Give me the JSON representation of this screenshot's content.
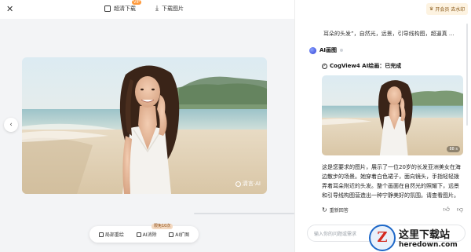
{
  "topbar": {
    "hd_download_label": "超清下载",
    "vip_badge": "VIP",
    "download_label": "下载图片"
  },
  "image": {
    "watermark": "清言·AI"
  },
  "actions": {
    "free_badge": "限免10次",
    "items": [
      {
        "label": "局部重绘"
      },
      {
        "label": "AI消除"
      },
      {
        "label": "AI扩图"
      }
    ]
  },
  "chat": {
    "upgrade_label": "开会员 去水印",
    "user_message": "耳朵的头发”，自然光，远景，引导线构图，超逼真 ...",
    "ai_name": "AI画图",
    "status": "CogView4 AI绘画：已完成",
    "thumb_tag": "88 s",
    "description": "这是您要求的图片，展示了一位20岁的长发亚洲美女在海边散步的场景。她穿着白色裙子，面向镜头，手指轻轻拨弄着耳朵附近的头发。整个画面在自然光的照耀下，远景和引导线构图营造出一种宁静美好的氛围。请查看图片。",
    "regenerate_label": "重新回答",
    "input_placeholder": "输入你的问题或需求"
  },
  "site_watermark": {
    "logo_letter": "Z",
    "name": "这里下载站",
    "url": "heredown.com"
  }
}
